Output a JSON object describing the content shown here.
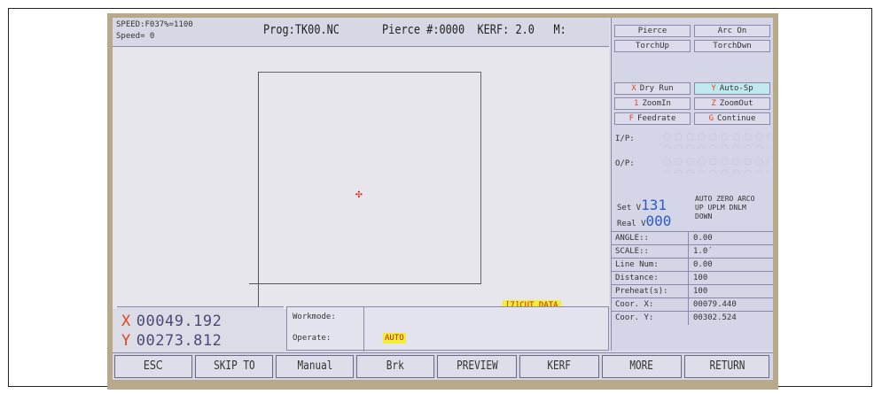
{
  "status": {
    "speed_line1": "SPEED:F037%=1100",
    "speed_line2": "Speed=  0",
    "program": "Prog:TK00.NC",
    "pierce_info": "Pierce #:0000  KERF: 2.0   M:"
  },
  "canvas": {
    "cut_data_label": "[7]CUT DATA",
    "torch_marker_icon": "crosshair-icon"
  },
  "coords": {
    "x_axis": "X",
    "x_value": "00049.192",
    "y_axis": "Y",
    "y_value": "00273.812"
  },
  "work": {
    "workmode_label": "Workmode:",
    "operate_label": "Operate:",
    "operate_value": "AUTO"
  },
  "right_panel": {
    "top_buttons": [
      "Pierce",
      "Arc On",
      "TorchUp",
      "TorchDwn"
    ],
    "options": [
      {
        "key": "X",
        "label": "Dry Run"
      },
      {
        "key": "Y",
        "label": "Auto-Sp"
      },
      {
        "key": "1",
        "label": "ZoomIn"
      },
      {
        "key": "Z",
        "label": "ZoomOut"
      },
      {
        "key": "F",
        "label": "Feedrate"
      },
      {
        "key": "G",
        "label": "Continue"
      }
    ],
    "input_label": "I/P:",
    "output_label": "O/P:",
    "set_label": "Set  V",
    "set_value": "131",
    "real_label": "Real V",
    "real_value": "000",
    "flags_line1": "AUTO ZERO ARCO",
    "flags_line2": "UP   UPLM DNLM",
    "flags_line3": "DOWN",
    "params": [
      {
        "label": "ANGLE::",
        "value": "0.00"
      },
      {
        "label": "SCALE::",
        "value": "1.0´"
      },
      {
        "label": "Line Num:",
        "value": "0.00"
      },
      {
        "label": "Distance:",
        "value": "100"
      },
      {
        "label": "Preheat(s):",
        "value": "100"
      },
      {
        "label": "Coor. X:",
        "value": "00079.440"
      },
      {
        "label": "Coor. Y:",
        "value": "00302.524"
      }
    ]
  },
  "function_keys": [
    "ESC",
    "SKIP TO",
    "Manual",
    "Brk",
    "PREVIEW",
    "KERF",
    "MORE",
    "RETURN"
  ],
  "colors": {
    "screen_bg": "#dcdce6",
    "bezel": "#b7a98a",
    "highlight_yellow": "#f2ee38",
    "key_red": "#d42",
    "value_blue": "#2a5acc"
  }
}
